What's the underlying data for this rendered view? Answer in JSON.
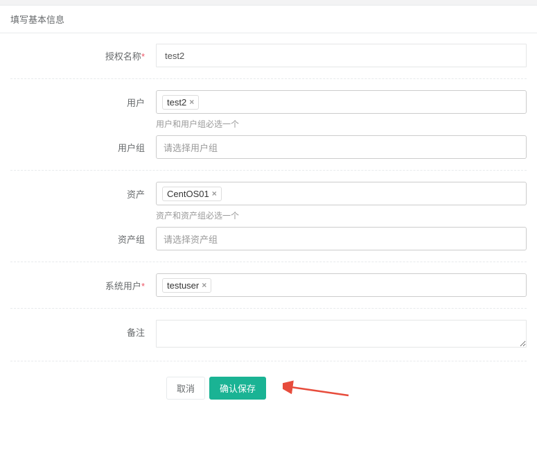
{
  "panel": {
    "title": "填写基本信息"
  },
  "labels": {
    "auth_name": "授权名称",
    "user": "用户",
    "user_group": "用户组",
    "asset": "资产",
    "asset_group": "资产组",
    "system_user": "系统用户",
    "remark": "备注",
    "star": "*"
  },
  "values": {
    "auth_name": "test2",
    "user_tags": [
      "test2"
    ],
    "user_group_placeholder": "请选择用户组",
    "asset_tags": [
      "CentOS01"
    ],
    "asset_group_placeholder": "请选择资产组",
    "system_user_tags": [
      "testuser"
    ],
    "remark": ""
  },
  "help": {
    "user": "用户和用户组必选一个",
    "asset": "资产和资产组必选一个"
  },
  "buttons": {
    "cancel": "取消",
    "save": "确认保存"
  },
  "colors": {
    "primary": "#1ab394",
    "danger": "#ed5565"
  }
}
